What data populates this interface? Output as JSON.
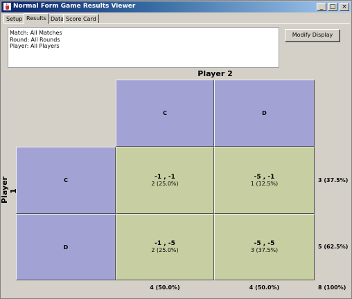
{
  "window": {
    "title": "Normal Form Game Results Viewer",
    "minimize_glyph": "_",
    "maximize_glyph": "□",
    "close_glyph": "×",
    "icon": "java-cup-icon"
  },
  "tabs": [
    {
      "label": "Setup",
      "active": false
    },
    {
      "label": "Results",
      "active": true
    },
    {
      "label": "Data",
      "active": false
    },
    {
      "label": "Score Card",
      "active": false
    }
  ],
  "info": {
    "match": "Match: All Matches",
    "round": "Round: All Rounds",
    "player": "Player: All Players"
  },
  "modify_button": "Modify Display",
  "matrix": {
    "player2_label": "Player 2",
    "player1_label": "Player 1",
    "col_headers": [
      "C",
      "D"
    ],
    "row_headers": [
      "C",
      "D"
    ],
    "cells": {
      "cc": {
        "payoff": "-1 , -1",
        "count": "2 (25.0%)"
      },
      "cd": {
        "payoff": "-5 , -1",
        "count": "1 (12.5%)"
      },
      "dc": {
        "payoff": "-1 , -5",
        "count": "2 (25.0%)"
      },
      "dd": {
        "payoff": "-5 , -5",
        "count": "3 (37.5%)"
      }
    },
    "row_totals": [
      "3 (37.5%)",
      "5 (62.5%)"
    ],
    "col_totals": [
      "4 (50.0%)",
      "4 (50.0%)"
    ],
    "grand_total": "8 (100%)"
  },
  "colors": {
    "header_cell": "#a2a2d4",
    "payoff_cell": "#c7cea2",
    "titlebar_start": "#0a246a",
    "titlebar_end": "#a6caf0"
  }
}
